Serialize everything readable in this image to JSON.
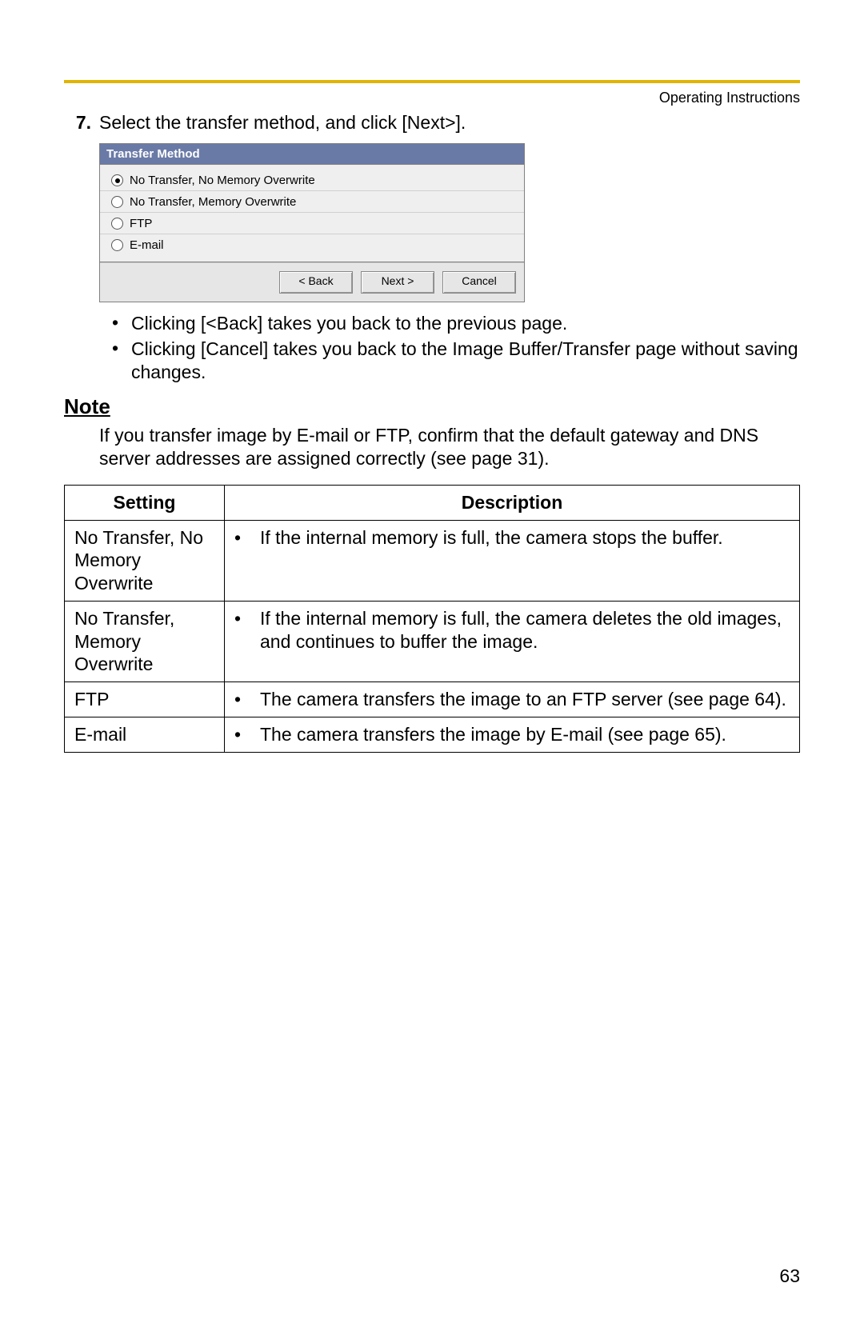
{
  "header": {
    "doc_title": "Operating Instructions"
  },
  "step": {
    "number": "7.",
    "text": "Select the transfer method, and click [Next>]."
  },
  "dialog": {
    "title": "Transfer Method",
    "options": [
      "No Transfer, No Memory Overwrite",
      "No Transfer, Memory Overwrite",
      "FTP",
      "E-mail"
    ],
    "buttons": {
      "back": "< Back",
      "next": "Next >",
      "cancel": "Cancel"
    }
  },
  "sub_bullets": [
    "Clicking [<Back] takes you back to the previous page.",
    "Clicking [Cancel] takes you back to the Image Buffer/Transfer page without saving changes."
  ],
  "note": {
    "heading": "Note",
    "body": "If you transfer image by E-mail or FTP, confirm that the default gateway and DNS server addresses are assigned correctly (see page 31)."
  },
  "table": {
    "headers": {
      "setting": "Setting",
      "description": "Description"
    },
    "rows": [
      {
        "setting": "No Transfer, No Memory Overwrite",
        "description": "If the internal memory is full, the camera stops the buffer."
      },
      {
        "setting": "No Transfer, Memory Overwrite",
        "description": "If the internal memory is full, the camera deletes the old images, and continues to buffer the image."
      },
      {
        "setting": "FTP",
        "description": "The camera transfers the image to an FTP server (see page 64)."
      },
      {
        "setting": "E-mail",
        "description": "The camera transfers the image by E-mail (see page 65)."
      }
    ]
  },
  "page_number": "63"
}
